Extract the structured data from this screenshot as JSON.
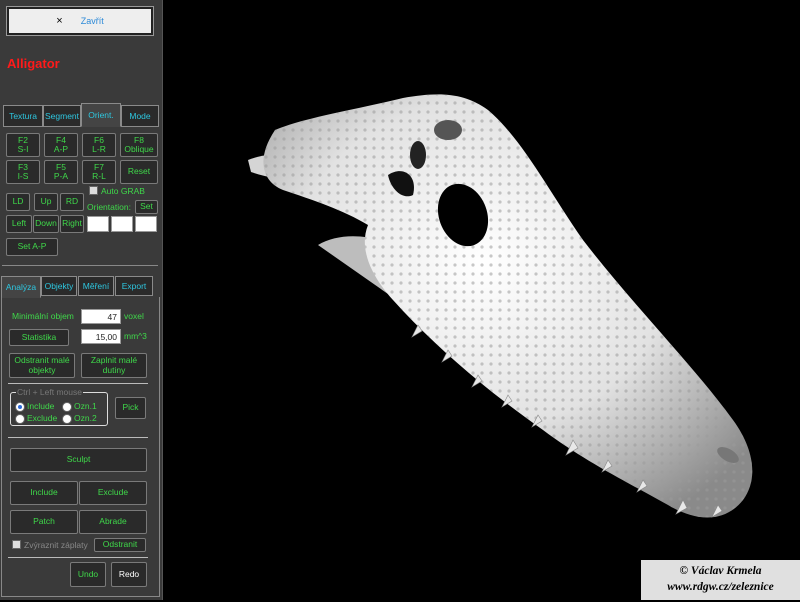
{
  "close": {
    "icon": "×",
    "label": "Zavřít"
  },
  "title": "Alligator",
  "tabs_top": [
    {
      "label": "Textura"
    },
    {
      "label": "Segment"
    },
    {
      "label": "Orient."
    },
    {
      "label": "Mode"
    }
  ],
  "orient": {
    "f2": "F2\nS-I",
    "f4": "F4\nA-P",
    "f6": "F6\nL-R",
    "f8": "F8\nOblique",
    "f3": "F3\nI-S",
    "f5": "F5\nP-A",
    "f7": "F7\nR-L",
    "reset": "Reset",
    "ld": "LD",
    "up": "Up",
    "rd": "RD",
    "left": "Left",
    "down": "Down",
    "right": "Right",
    "auto_grab": "Auto GRAB",
    "orientation": "Orientation:",
    "set": "Set",
    "set_ap": "Set A-P"
  },
  "tabs_bottom": [
    {
      "label": "Analýza"
    },
    {
      "label": "Objekty"
    },
    {
      "label": "Měření"
    },
    {
      "label": "Export"
    }
  ],
  "analysis": {
    "min_volume_label": "Minimální objem",
    "min_volume_value": "47",
    "min_volume_unit": "voxel",
    "statistics": "Statistika",
    "stat_value": "15,00",
    "stat_unit": "mm^3",
    "remove_small": "Odstranit malé\nobjekty",
    "fill_small": "Zaplnit malé\ndutiny",
    "group_label": "Ctrl + Left mouse",
    "include": "Include",
    "exclude": "Exclude",
    "ozn1": "Ozn.1",
    "ozn2": "Ozn.2",
    "pick": "Pick",
    "sculpt": "Sculpt",
    "include_btn": "Include",
    "exclude_btn": "Exclude",
    "patch": "Patch",
    "abrade": "Abrade",
    "highlight_patches": "Zvýraznit záplaty",
    "remove": "Odstranit",
    "undo": "Undo",
    "redo": "Redo"
  },
  "watermark": {
    "line1": "© Václav Krmela",
    "line2": "www.rdgw.cz/zeleznice"
  },
  "colors": {
    "accent_text": "#3fd84a",
    "tab_text": "#2ec7e0",
    "title": "#ff1a1a"
  }
}
